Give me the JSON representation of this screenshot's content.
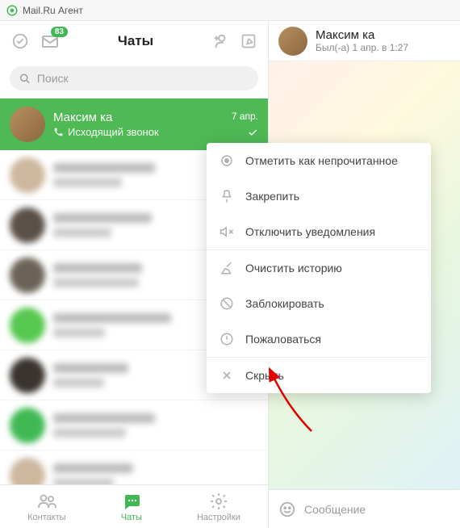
{
  "app": {
    "title": "Mail.Ru Агент"
  },
  "sidebar": {
    "title": "Чаты",
    "unread_badge": "83",
    "search_placeholder": "Поиск"
  },
  "selected_chat": {
    "name": "Максим ка",
    "subtitle": "Исходящий звонок",
    "date": "7 апр."
  },
  "nav": {
    "contacts": "Контакты",
    "chats": "Чаты",
    "settings": "Настройки"
  },
  "header": {
    "name": "Максим ка",
    "status": "Был(-а) 1 апр. в 1:27"
  },
  "composer": {
    "placeholder": "Сообщение"
  },
  "context_menu": {
    "mark_unread": "Отметить как непрочитанное",
    "pin": "Закрепить",
    "mute": "Отключить уведомления",
    "clear": "Очистить историю",
    "block": "Заблокировать",
    "report": "Пожаловаться",
    "hide": "Скрыть"
  },
  "blur_avatars": [
    "#cdb79e",
    "#5a5048",
    "#6b6358",
    "#56c84f",
    "#3a342e",
    "#3fb954",
    "#cdb79e"
  ]
}
